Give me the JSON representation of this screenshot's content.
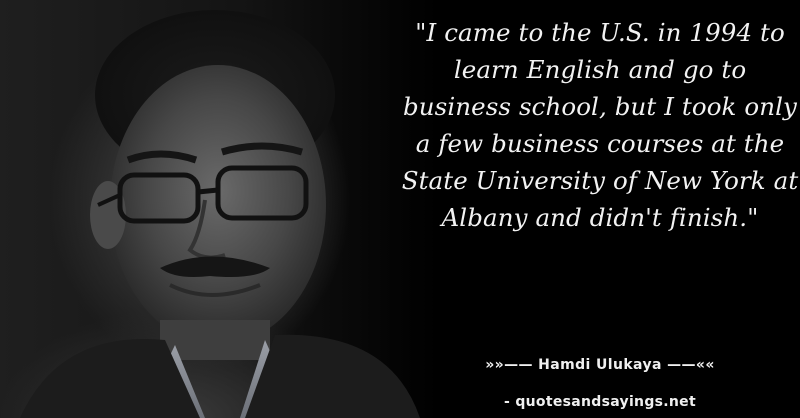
{
  "quote": {
    "text": "\"I came to the U.S. in 1994 to learn English and go to business school, but I took only a few business courses at the State University of New York at Albany and didn't finish.\""
  },
  "attribution": {
    "author_line": "»»—— Hamdi Ulukaya ——««"
  },
  "watermark": {
    "site": "- quotesandsayings.net"
  }
}
